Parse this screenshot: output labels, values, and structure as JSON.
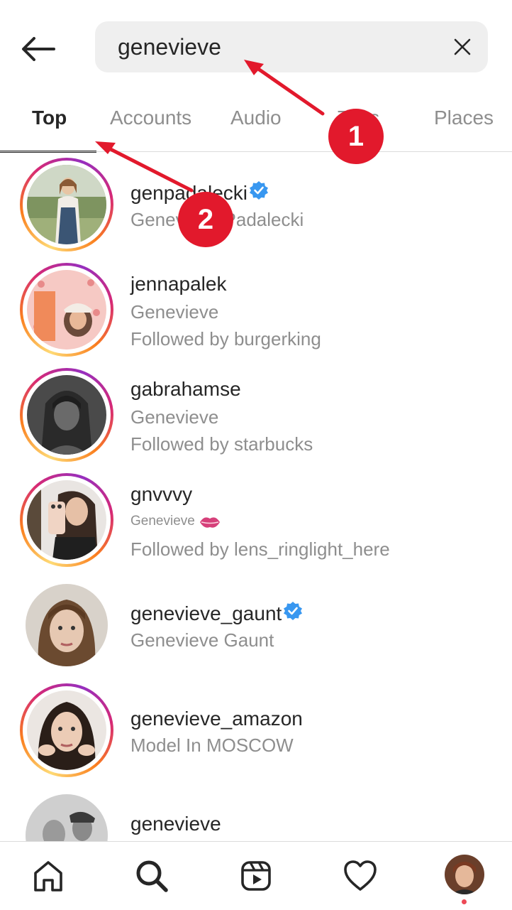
{
  "header": {
    "back_icon": "arrow-left-icon",
    "search_value": "genevieve",
    "clear_icon": "close-icon"
  },
  "tabs": [
    {
      "label": "Top",
      "active": true
    },
    {
      "label": "Accounts",
      "active": false
    },
    {
      "label": "Audio",
      "active": false
    },
    {
      "label": "Tags",
      "active": false
    },
    {
      "label": "Places",
      "active": false
    }
  ],
  "results": [
    {
      "username": "genpadalecki",
      "verified": true,
      "name": "Genevieve Padalecki",
      "followed_by": "",
      "story_ring": true
    },
    {
      "username": "jennapalek",
      "verified": false,
      "name": "Genevieve",
      "followed_by": "Followed by burgerking",
      "story_ring": true
    },
    {
      "username": "gabrahamse",
      "verified": false,
      "name": "Genevieve",
      "followed_by": "Followed by starbucks",
      "story_ring": true
    },
    {
      "username": "gnvvvy",
      "verified": false,
      "name": "Genevieve",
      "name_emoji": "kiss-mark-icon",
      "followed_by": "Followed by lens_ringlight_here",
      "story_ring": true
    },
    {
      "username": "genevieve_gaunt",
      "verified": true,
      "name": "Genevieve Gaunt",
      "followed_by": "",
      "story_ring": false
    },
    {
      "username": "genevieve_amazon",
      "verified": false,
      "name": "Model In MOSCOW",
      "followed_by": "",
      "story_ring": true
    },
    {
      "username": "genevieve",
      "verified": false,
      "name": "",
      "followed_by": "",
      "story_ring": false
    }
  ],
  "annotations": [
    {
      "number": "1"
    },
    {
      "number": "2"
    }
  ],
  "bottom_nav": [
    {
      "icon": "home-icon"
    },
    {
      "icon": "search-icon"
    },
    {
      "icon": "reels-icon"
    },
    {
      "icon": "heart-icon"
    },
    {
      "icon": "profile-avatar"
    }
  ],
  "colors": {
    "accent_verified": "#3897f0",
    "annotation_red": "#e2192c",
    "secondary_text": "#8e8e8e"
  }
}
